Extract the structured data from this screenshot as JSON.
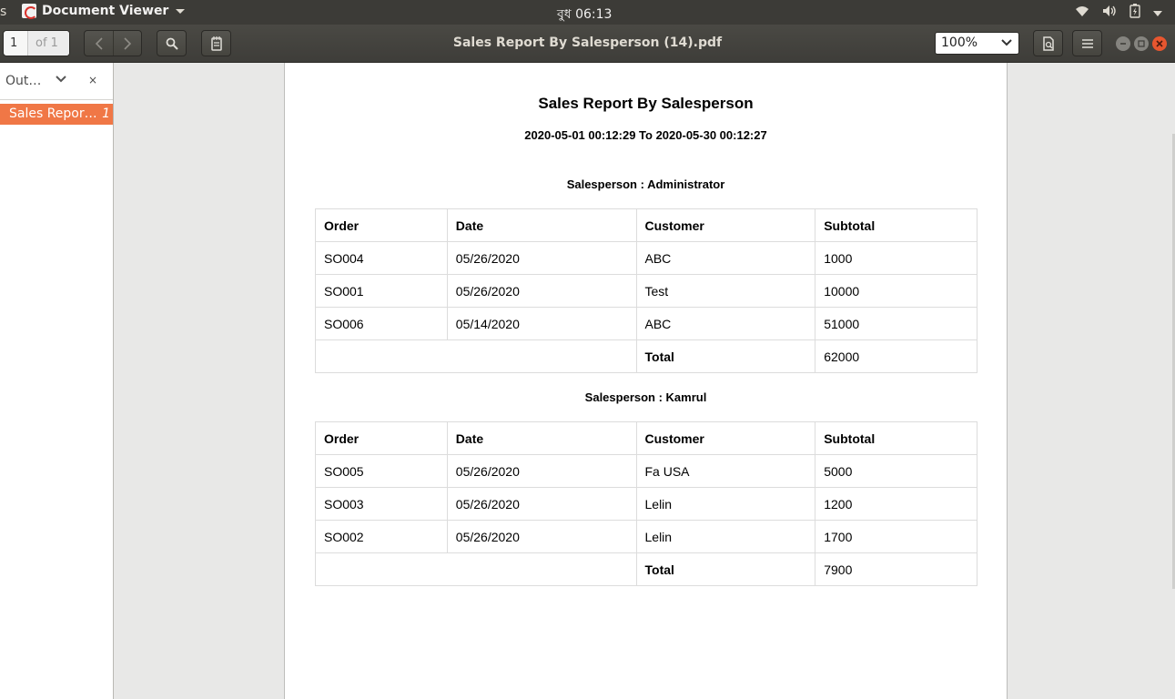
{
  "system": {
    "left_fragment": "s",
    "app_name": "Document Viewer",
    "clock": "বুধ 06:13"
  },
  "toolbar": {
    "page_number": "1",
    "page_of": "of 1",
    "document_title": "Sales Report By Salesperson (14).pdf",
    "zoom": "100%"
  },
  "sidebar": {
    "mode_label": "Out…",
    "close_glyph": "×",
    "items": [
      {
        "label": "Sales Repor…",
        "page": "1"
      }
    ]
  },
  "report": {
    "title": "Sales Report By Salesperson",
    "date_range": "2020-05-01 00:12:29 To 2020-05-30 00:12:27",
    "columns": [
      "Order",
      "Date",
      "Customer",
      "Subtotal"
    ],
    "total_label": "Total",
    "sections": [
      {
        "salesperson": "Salesperson : Administrator",
        "rows": [
          [
            "SO004",
            "05/26/2020",
            "ABC",
            "1000"
          ],
          [
            "SO001",
            "05/26/2020",
            "Test",
            "10000"
          ],
          [
            "SO006",
            "05/14/2020",
            "ABC",
            "51000"
          ]
        ],
        "total": "62000"
      },
      {
        "salesperson": "Salesperson : Kamrul",
        "rows": [
          [
            "SO005",
            "05/26/2020",
            "Fa USA",
            "5000"
          ],
          [
            "SO003",
            "05/26/2020",
            "Lelin",
            "1200"
          ],
          [
            "SO002",
            "05/26/2020",
            "Lelin",
            "1700"
          ]
        ],
        "total": "7900"
      }
    ]
  }
}
